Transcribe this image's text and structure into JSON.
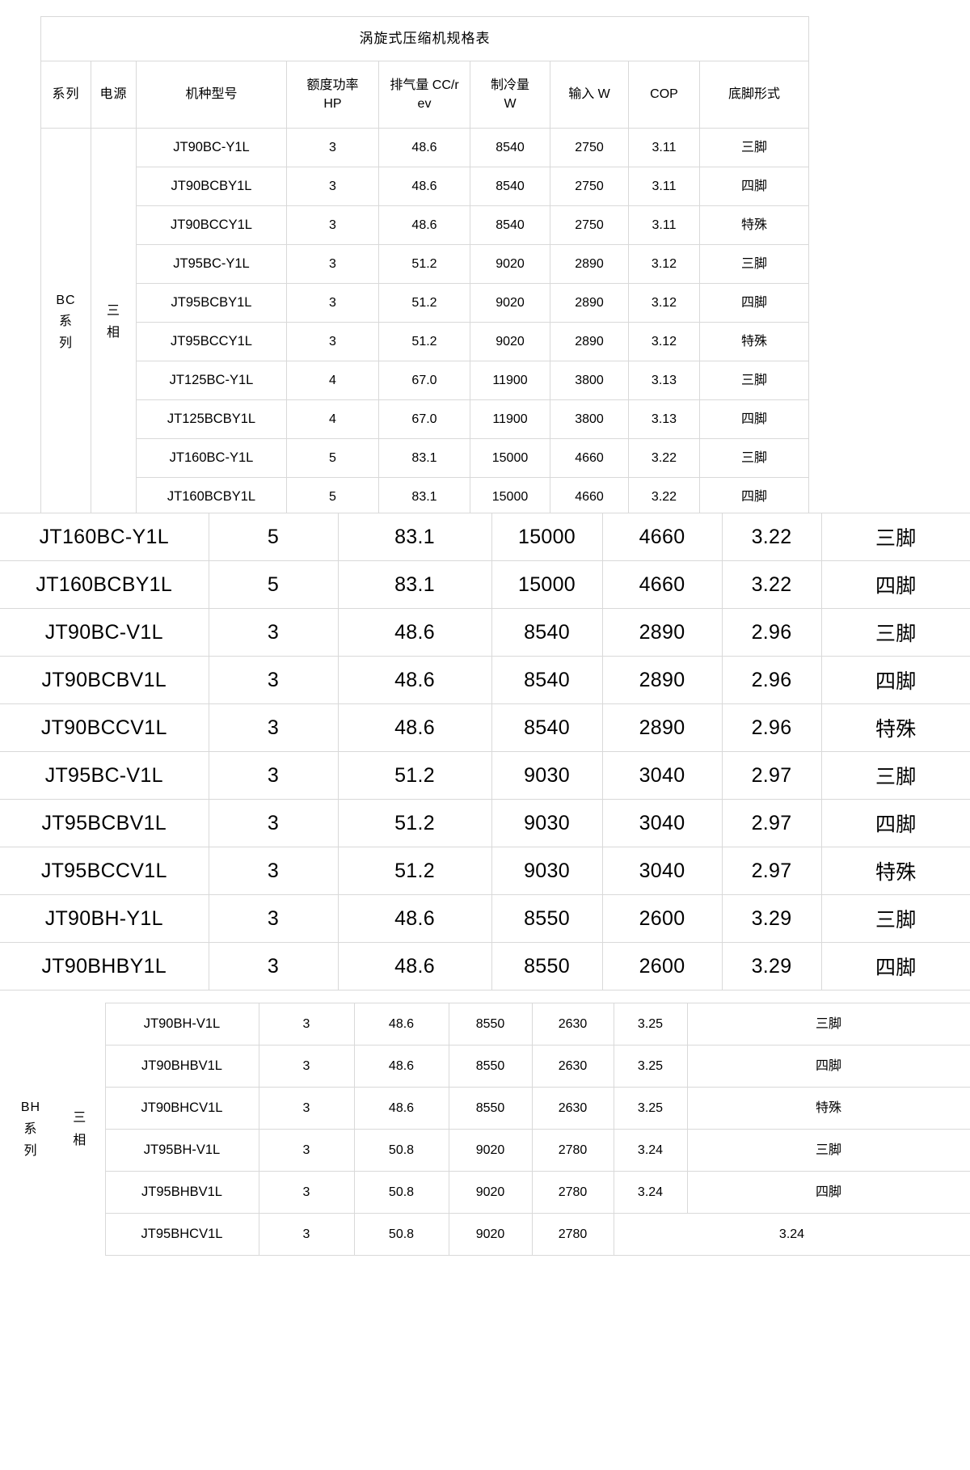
{
  "document": {
    "title": "涡旋式压缩机规格表"
  },
  "columns": {
    "series": "系列",
    "power_source": "电源",
    "model": "机种型号",
    "rated_power_line1": "额度功率",
    "rated_power_line2": "HP",
    "displacement_line1": "排气量 CC/r",
    "displacement_line2": "ev",
    "cooling_line1": "制冷量",
    "cooling_line2": "W",
    "input": "输入 W",
    "cop": "COP",
    "foot_type": "底脚形式"
  },
  "section_top": {
    "series_label": "BC 系列",
    "series_chars": [
      "BC",
      "系",
      "列"
    ],
    "power_label": "三相",
    "power_chars": [
      "三",
      "相"
    ],
    "rows": [
      {
        "model": "JT90BC-Y1L",
        "hp": "3",
        "disp": "48.6",
        "cooling": "8540",
        "input": "2750",
        "cop": "3.11",
        "foot": "三脚"
      },
      {
        "model": "JT90BCBY1L",
        "hp": "3",
        "disp": "48.6",
        "cooling": "8540",
        "input": "2750",
        "cop": "3.11",
        "foot": "四脚"
      },
      {
        "model": "JT90BCCY1L",
        "hp": "3",
        "disp": "48.6",
        "cooling": "8540",
        "input": "2750",
        "cop": "3.11",
        "foot": "特殊"
      },
      {
        "model": "JT95BC-Y1L",
        "hp": "3",
        "disp": "51.2",
        "cooling": "9020",
        "input": "2890",
        "cop": "3.12",
        "foot": "三脚"
      },
      {
        "model": "JT95BCBY1L",
        "hp": "3",
        "disp": "51.2",
        "cooling": "9020",
        "input": "2890",
        "cop": "3.12",
        "foot": "四脚"
      },
      {
        "model": "JT95BCCY1L",
        "hp": "3",
        "disp": "51.2",
        "cooling": "9020",
        "input": "2890",
        "cop": "3.12",
        "foot": "特殊"
      },
      {
        "model": "JT125BC-Y1L",
        "hp": "4",
        "disp": "67.0",
        "cooling": "11900",
        "input": "3800",
        "cop": "3.13",
        "foot": "三脚"
      },
      {
        "model": "JT125BCBY1L",
        "hp": "4",
        "disp": "67.0",
        "cooling": "11900",
        "input": "3800",
        "cop": "3.13",
        "foot": "四脚"
      },
      {
        "model": "JT160BC-Y1L",
        "hp": "5",
        "disp": "83.1",
        "cooling": "15000",
        "input": "4660",
        "cop": "3.22",
        "foot": "三脚"
      },
      {
        "model": "JT160BCBY1L",
        "hp": "5",
        "disp": "83.1",
        "cooling": "15000",
        "input": "4660",
        "cop": "3.22",
        "foot": "四脚"
      }
    ]
  },
  "section_middle": {
    "rows": [
      {
        "model": "JT160BC-Y1L",
        "hp": "5",
        "disp": "83.1",
        "cooling": "15000",
        "input": "4660",
        "cop": "3.22",
        "foot": "三脚"
      },
      {
        "model": "JT160BCBY1L",
        "hp": "5",
        "disp": "83.1",
        "cooling": "15000",
        "input": "4660",
        "cop": "3.22",
        "foot": "四脚"
      },
      {
        "model": "JT90BC-V1L",
        "hp": "3",
        "disp": "48.6",
        "cooling": "8540",
        "input": "2890",
        "cop": "2.96",
        "foot": "三脚"
      },
      {
        "model": "JT90BCBV1L",
        "hp": "3",
        "disp": "48.6",
        "cooling": "8540",
        "input": "2890",
        "cop": "2.96",
        "foot": "四脚"
      },
      {
        "model": "JT90BCCV1L",
        "hp": "3",
        "disp": "48.6",
        "cooling": "8540",
        "input": "2890",
        "cop": "2.96",
        "foot": "特殊"
      },
      {
        "model": "JT95BC-V1L",
        "hp": "3",
        "disp": "51.2",
        "cooling": "9030",
        "input": "3040",
        "cop": "2.97",
        "foot": "三脚"
      },
      {
        "model": "JT95BCBV1L",
        "hp": "3",
        "disp": "51.2",
        "cooling": "9030",
        "input": "3040",
        "cop": "2.97",
        "foot": "四脚"
      },
      {
        "model": "JT95BCCV1L",
        "hp": "3",
        "disp": "51.2",
        "cooling": "9030",
        "input": "3040",
        "cop": "2.97",
        "foot": "特殊"
      },
      {
        "model": "JT90BH-Y1L",
        "hp": "3",
        "disp": "48.6",
        "cooling": "8550",
        "input": "2600",
        "cop": "3.29",
        "foot": "三脚"
      },
      {
        "model": "JT90BHBY1L",
        "hp": "3",
        "disp": "48.6",
        "cooling": "8550",
        "input": "2600",
        "cop": "3.29",
        "foot": "四脚"
      }
    ]
  },
  "section_bottom": {
    "series_label": "BH 系列",
    "series_chars": [
      "BH",
      "系",
      "列"
    ],
    "power_label": "三相",
    "power_chars": [
      "三",
      "相"
    ],
    "rows": [
      {
        "model": "JT90BH-V1L",
        "hp": "3",
        "disp": "48.6",
        "cooling": "8550",
        "input": "2630",
        "cop": "3.25",
        "foot": "三脚",
        "merged": false
      },
      {
        "model": "JT90BHBV1L",
        "hp": "3",
        "disp": "48.6",
        "cooling": "8550",
        "input": "2630",
        "cop": "3.25",
        "foot": "四脚",
        "merged": false
      },
      {
        "model": "JT90BHCV1L",
        "hp": "3",
        "disp": "48.6",
        "cooling": "8550",
        "input": "2630",
        "cop": "3.25",
        "foot": "特殊",
        "merged": false
      },
      {
        "model": "JT95BH-V1L",
        "hp": "3",
        "disp": "50.8",
        "cooling": "9020",
        "input": "2780",
        "cop": "3.24",
        "foot": "三脚",
        "merged": false
      },
      {
        "model": "JT95BHBV1L",
        "hp": "3",
        "disp": "50.8",
        "cooling": "9020",
        "input": "2780",
        "cop": "3.24",
        "foot": "四脚",
        "merged": false
      },
      {
        "model": "JT95BHCV1L",
        "hp": "3",
        "disp": "50.8",
        "cooling": "9020",
        "input": "2780",
        "cop": "3.24",
        "foot": "",
        "merged": true
      }
    ]
  },
  "colors": {
    "border": "#d9d9d9",
    "text": "#000000",
    "background": "#ffffff"
  }
}
